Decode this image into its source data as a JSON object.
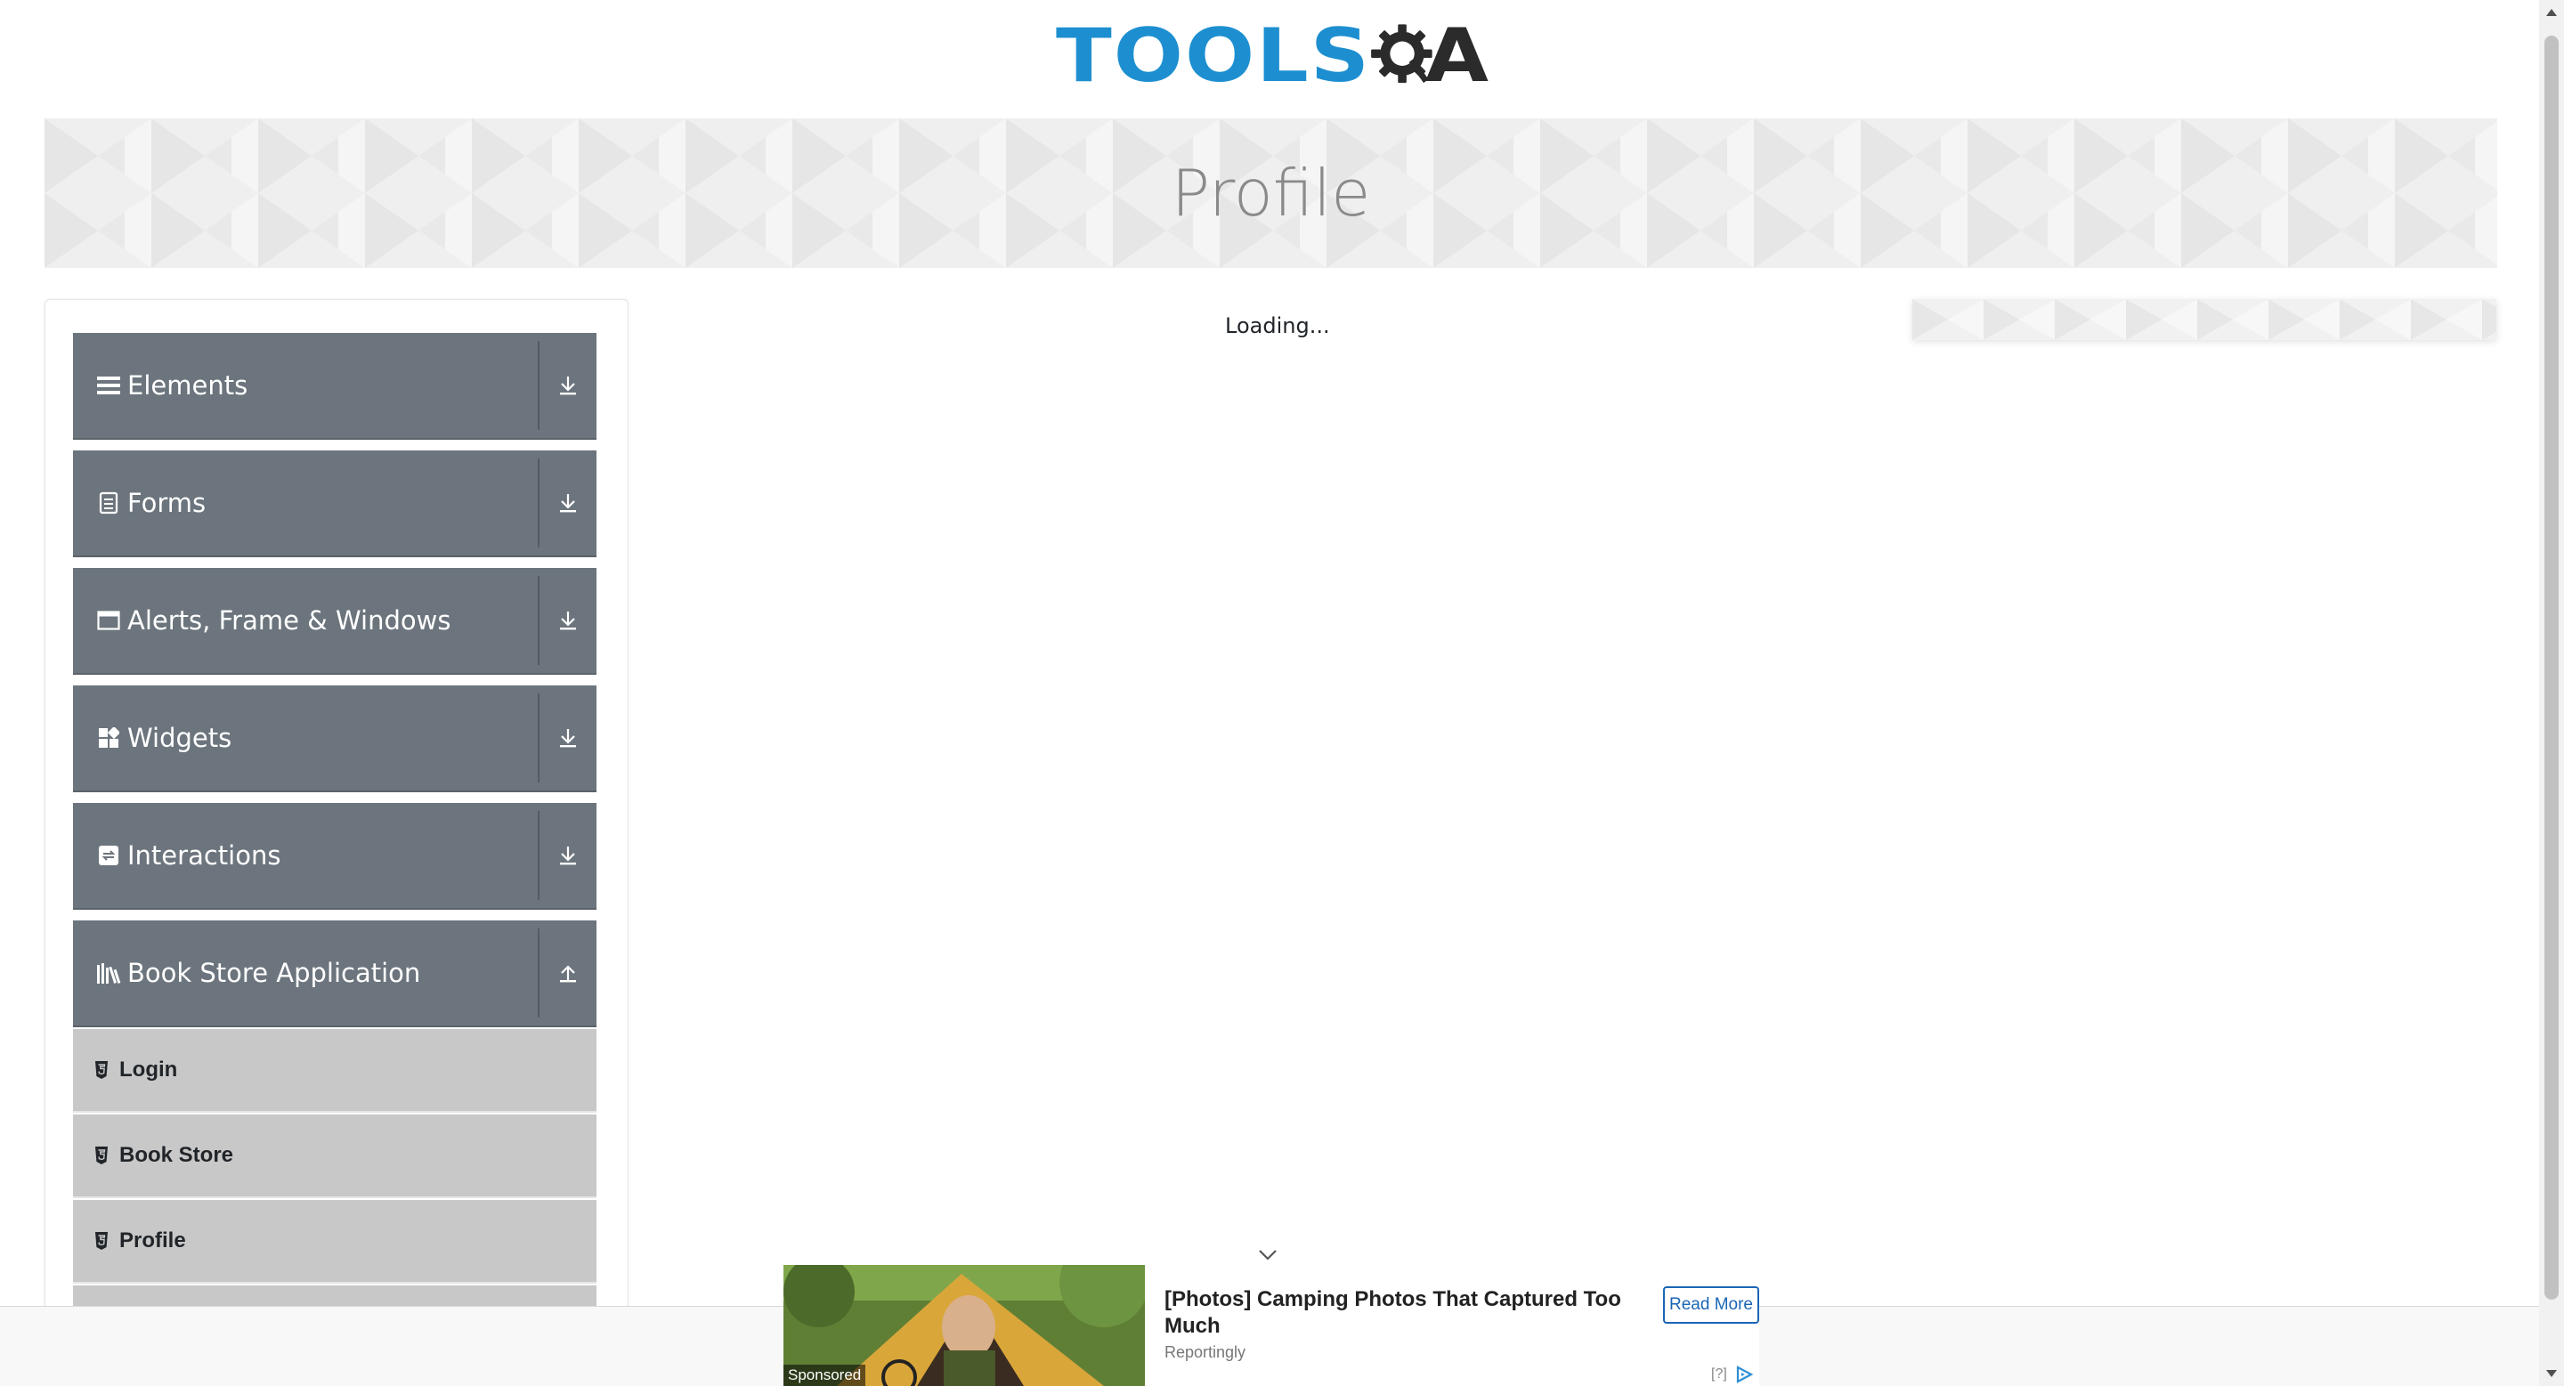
{
  "header": {
    "logo_text_left": "TOOLS",
    "logo_text_right": "A",
    "page_title": "Profile"
  },
  "sidebar": {
    "groups": [
      {
        "label": "Elements",
        "icon": "list-icon",
        "expanded": false
      },
      {
        "label": "Forms",
        "icon": "document-icon",
        "expanded": false
      },
      {
        "label": "Alerts, Frame & Windows",
        "icon": "window-icon",
        "expanded": false
      },
      {
        "label": "Widgets",
        "icon": "widgets-icon",
        "expanded": false
      },
      {
        "label": "Interactions",
        "icon": "interactions-icon",
        "expanded": false
      },
      {
        "label": "Book Store Application",
        "icon": "books-icon",
        "expanded": true
      }
    ],
    "subitems": [
      {
        "label": "Login",
        "icon": "html5-icon"
      },
      {
        "label": "Book Store",
        "icon": "html5-icon"
      },
      {
        "label": "Profile",
        "icon": "html5-icon"
      }
    ]
  },
  "main": {
    "status_text": "Loading..."
  },
  "ad": {
    "sponsored_label": "Sponsored",
    "title": "[Photos] Camping Photos That Captured Too Much",
    "source": "Reportingly",
    "cta_label": "Read More",
    "info_label": "[?]"
  },
  "colors": {
    "brand_blue": "#1d8fd0",
    "sidebar_group_bg": "#6c757d",
    "sidebar_sub_bg": "#c8c8c8",
    "ad_cta": "#1a66b5"
  }
}
